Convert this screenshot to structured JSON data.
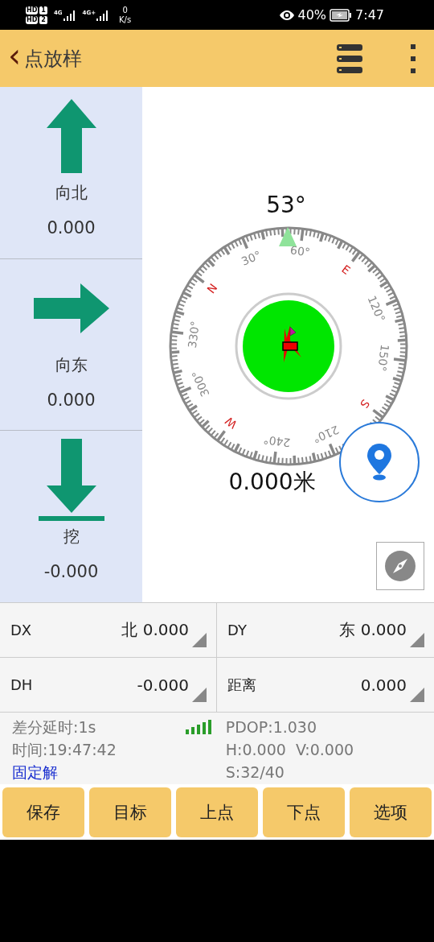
{
  "status_bar": {
    "sims": [
      {
        "badge": "HD",
        "slot": "1",
        "network": "4G"
      },
      {
        "badge": "HD",
        "slot": "2",
        "network": "4G+"
      }
    ],
    "speed_value": "0",
    "speed_unit": "K/s",
    "battery": "40%",
    "time": "7:47"
  },
  "app_bar": {
    "back": "‹",
    "title": "点放样"
  },
  "directions": [
    {
      "kind": "north",
      "label": "向北",
      "value": "0.000"
    },
    {
      "kind": "east",
      "label": "向东",
      "value": "0.000"
    },
    {
      "kind": "dig",
      "label": "挖",
      "value": "-0.000"
    }
  ],
  "compass": {
    "heading": "53°",
    "distance": "0.000米",
    "dial": [
      {
        "kind": "cardinal",
        "text": "N"
      },
      {
        "kind": "degree",
        "text": "30°"
      },
      {
        "kind": "degree",
        "text": "60°"
      },
      {
        "kind": "cardinal",
        "text": "E"
      },
      {
        "kind": "degree",
        "text": "120°"
      },
      {
        "kind": "degree",
        "text": "150°"
      },
      {
        "kind": "cardinal",
        "text": "S"
      },
      {
        "kind": "degree",
        "text": "210°"
      },
      {
        "kind": "degree",
        "text": "240°"
      },
      {
        "kind": "cardinal",
        "text": "W"
      },
      {
        "kind": "degree",
        "text": "300°"
      },
      {
        "kind": "degree",
        "text": "330°"
      }
    ]
  },
  "fields": [
    {
      "label": "DX",
      "value": "北 0.000"
    },
    {
      "label": "DY",
      "value": "东 0.000"
    },
    {
      "label": "DH",
      "value": "-0.000"
    },
    {
      "label": "距离",
      "value": "0.000"
    }
  ],
  "info": {
    "delay": "差分延时:1s",
    "time": "时间:19:47:42",
    "solution": "固定解",
    "pdop": "PDOP:1.030",
    "hv": "H:0.000  V:0.000",
    "sats": "S:32/40"
  },
  "buttons": [
    "保存",
    "目标",
    "上点",
    "下点",
    "选项"
  ]
}
